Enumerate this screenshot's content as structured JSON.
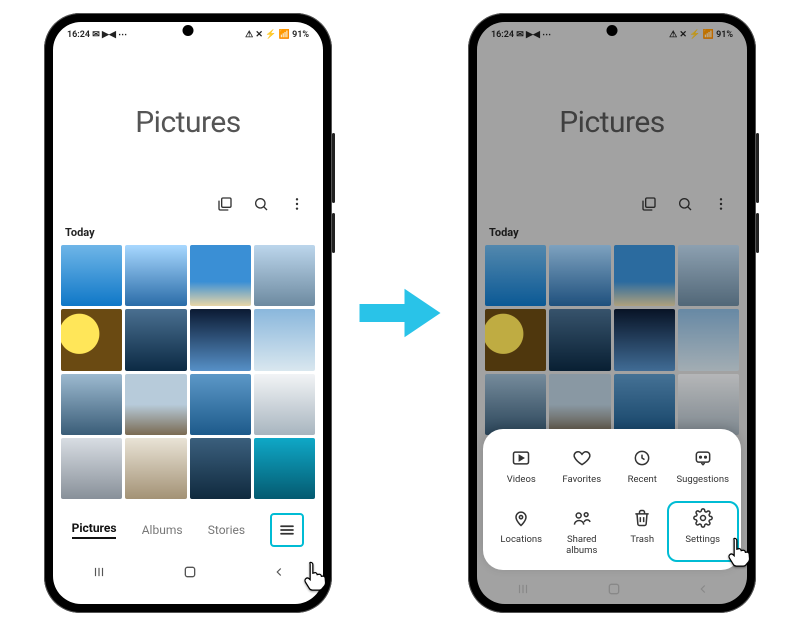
{
  "status": {
    "time": "16:24",
    "left_extra": "✉ ▶◀ ⋯",
    "right": "⚠ ✕ ⚡ 📶 91%"
  },
  "header": {
    "title": "Pictures"
  },
  "section": {
    "today": "Today"
  },
  "tabs": {
    "pictures": "Pictures",
    "albums": "Albums",
    "stories": "Stories"
  },
  "sheet": {
    "videos": "Videos",
    "favorites": "Favorites",
    "recent": "Recent",
    "suggestions": "Suggestions",
    "locations": "Locations",
    "shared": "Shared\nalbums",
    "trash": "Trash",
    "settings": "Settings"
  },
  "colors": {
    "accent": "#00bcd4"
  }
}
